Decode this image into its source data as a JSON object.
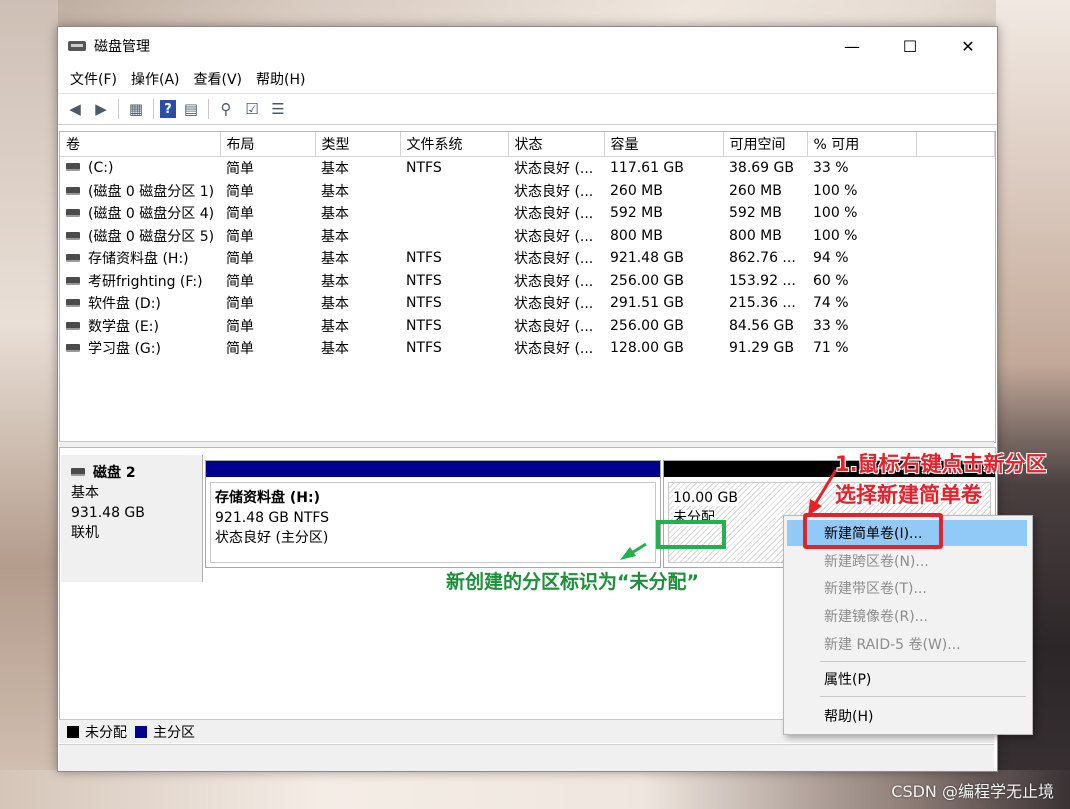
{
  "window": {
    "title": "磁盘管理",
    "controls": {
      "minimize": "—",
      "maximize": "☐",
      "close": "✕"
    }
  },
  "menubar": [
    "文件(F)",
    "操作(A)",
    "查看(V)",
    "帮助(H)"
  ],
  "toolbar_icons": [
    "back-arrow-icon",
    "forward-arrow-icon",
    "list-view-icon",
    "help-icon",
    "details-view-icon",
    "connect-icon",
    "check-icon",
    "properties-icon"
  ],
  "volume_table": {
    "columns": [
      "卷",
      "布局",
      "类型",
      "文件系统",
      "状态",
      "容量",
      "可用空间",
      "% 可用"
    ],
    "rows": [
      [
        "(C:)",
        "简单",
        "基本",
        "NTFS",
        "状态良好 (...",
        "117.61 GB",
        "38.69 GB",
        "33 %"
      ],
      [
        "(磁盘 0 磁盘分区 1)",
        "简单",
        "基本",
        "",
        "状态良好 (...",
        "260 MB",
        "260 MB",
        "100 %"
      ],
      [
        "(磁盘 0 磁盘分区 4)",
        "简单",
        "基本",
        "",
        "状态良好 (...",
        "592 MB",
        "592 MB",
        "100 %"
      ],
      [
        "(磁盘 0 磁盘分区 5)",
        "简单",
        "基本",
        "",
        "状态良好 (...",
        "800 MB",
        "800 MB",
        "100 %"
      ],
      [
        "存储资料盘 (H:)",
        "简单",
        "基本",
        "NTFS",
        "状态良好 (...",
        "921.48 GB",
        "862.76 ...",
        "94 %"
      ],
      [
        "考研frighting (F:)",
        "简单",
        "基本",
        "NTFS",
        "状态良好 (...",
        "256.00 GB",
        "153.92 ...",
        "60 %"
      ],
      [
        "软件盘 (D:)",
        "简单",
        "基本",
        "NTFS",
        "状态良好 (...",
        "291.51 GB",
        "215.36 ...",
        "74 %"
      ],
      [
        "数学盘 (E:)",
        "简单",
        "基本",
        "NTFS",
        "状态良好 (...",
        "256.00 GB",
        "84.56 GB",
        "33 %"
      ],
      [
        "学习盘 (G:)",
        "简单",
        "基本",
        "NTFS",
        "状态良好 (...",
        "128.00 GB",
        "91.29 GB",
        "71 %"
      ]
    ]
  },
  "disk": {
    "name": "磁盘 2",
    "type": "基本",
    "size": "931.48 GB",
    "status": "联机",
    "partition": {
      "name": "存储资料盘 (H:)",
      "size_fs": "921.48 GB NTFS",
      "status": "状态良好 (主分区)",
      "band_color": "#00008b"
    },
    "unallocated": {
      "size": "10.00 GB",
      "label": "未分配",
      "band_color": "#000000"
    }
  },
  "legend": [
    {
      "label": "未分配",
      "color": "#000000"
    },
    {
      "label": "主分区",
      "color": "#00008b"
    }
  ],
  "context_menu": {
    "items": [
      {
        "label": "新建简单卷(I)...",
        "enabled": true,
        "highlighted": true
      },
      {
        "label": "新建跨区卷(N)...",
        "enabled": false
      },
      {
        "label": "新建带区卷(T)...",
        "enabled": false
      },
      {
        "label": "新建镜像卷(R)...",
        "enabled": false
      },
      {
        "label": "新建 RAID-5 卷(W)...",
        "enabled": false
      },
      {
        "label": "属性(P)",
        "enabled": true
      },
      {
        "label": "帮助(H)",
        "enabled": true
      }
    ]
  },
  "annotations": {
    "step1_line1": "1.鼠标右键点击新分区",
    "step1_line2": "选择新建简单卷",
    "note": "新创建的分区标识为“未分配”",
    "red_color": "#e8202a",
    "green_color": "#22b14c"
  },
  "watermark": "CSDN @编程学无止境"
}
